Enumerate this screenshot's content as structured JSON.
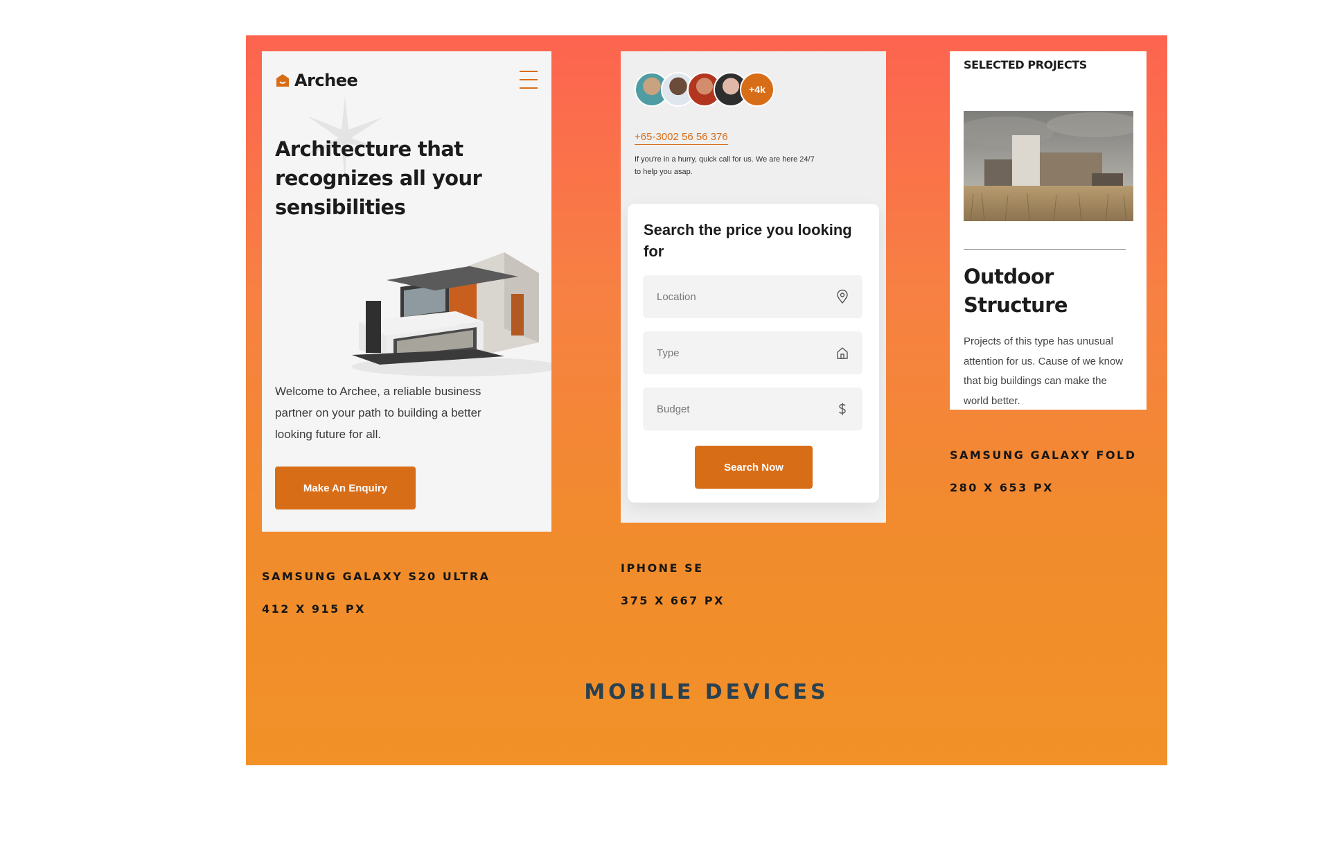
{
  "brand": {
    "logo_text": "Archee"
  },
  "colors": {
    "accent": "#d86d18",
    "title_dark": "#294150"
  },
  "screen1": {
    "hero_title": "Architecture that recognizes all your sensibilities",
    "hero_text": "Welcome to Archee, a reliable business partner on your path to building a better looking future for all.",
    "cta_label": "Make An Enquiry"
  },
  "device1": {
    "name": "SAMSUNG GALAXY S20 ULTRA",
    "size": "412 X 915 PX"
  },
  "screen2": {
    "avatar_count": "+4k",
    "phone": "+65-3002 56 56 376",
    "hurry_text": "If you're in a hurry, quick call for us. We are here 24/7 to help you asap.",
    "search_title": "Search the price you looking for",
    "location_placeholder": "Location",
    "type_placeholder": "Type",
    "budget_placeholder": "Budget",
    "search_button": "Search Now"
  },
  "device2": {
    "name": "IPHONE SE",
    "size": "375 X 667 PX"
  },
  "screen3": {
    "section_label": "SELECTED PROJECTS",
    "project_title": "Outdoor Structure",
    "project_text": "Projects of this type has unusual attention for us. Cause of we know that big buildings can make the world better."
  },
  "device3": {
    "name": "SAMSUNG GALAXY FOLD",
    "size": "280 X 653 PX"
  },
  "page_title": "MOBILE DEVICES"
}
